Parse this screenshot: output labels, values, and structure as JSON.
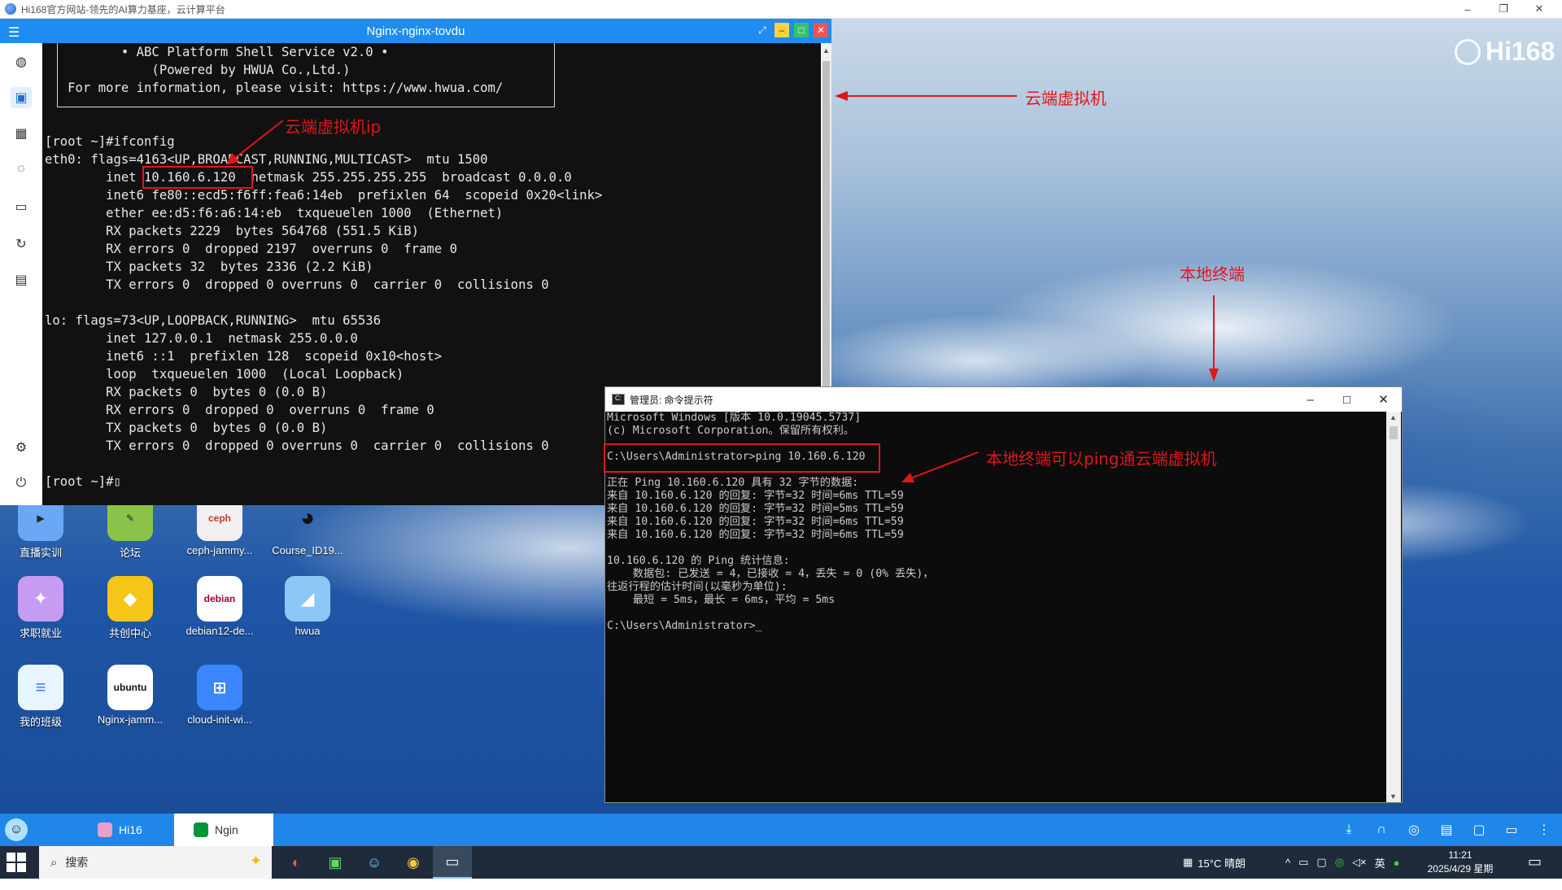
{
  "outer_window": {
    "title": "Hi168官方网站-领先的AI算力基座，云计算平台",
    "minimize": "–",
    "restore": "❐",
    "close": "✕"
  },
  "desktop": {
    "brand": "Hi168",
    "icons": [
      {
        "label": "直播实训",
        "icon": "video-play-icon",
        "color": "#6aa7f5"
      },
      {
        "label": "论坛",
        "icon": "forum-icon",
        "color": "#8bc34a"
      },
      {
        "label": "ceph-jammy...",
        "icon": "ceph-icon",
        "color": "#f0f0f0"
      },
      {
        "label": "Course_ID19...",
        "icon": "penguin-icon",
        "color": "#222222"
      },
      {
        "label": "求职就业",
        "icon": "job-icon",
        "color": "#c59cf2"
      },
      {
        "label": "共创中心",
        "icon": "cocreate-icon",
        "color": "#f5c518"
      },
      {
        "label": "debian12-de...",
        "icon": "debian-icon",
        "icon_text": "debian",
        "color": "#ffffff"
      },
      {
        "label": "hwua",
        "icon": "hwua-icon",
        "color": "#8cc8f5"
      },
      {
        "label": "我的班级",
        "icon": "class-icon",
        "color": "#e8f4ff"
      },
      {
        "label": "Nginx-jamm...",
        "icon": "ubuntu-icon",
        "icon_text": "ubuntu",
        "color": "#ffffff"
      },
      {
        "label": "cloud-init-wi...",
        "icon": "windows11-icon",
        "color": "#3a86ff"
      }
    ]
  },
  "annotations": {
    "vm_ip": "云端虚拟机ip",
    "cloud_vm": "云端虚拟机",
    "local_terminal": "本地终端",
    "ping_ok": "本地终端可以ping通云端虚拟机"
  },
  "nginx_window": {
    "title": "Nginx-nginx-tovdu",
    "sidebar": [
      "globe-icon",
      "terminal-icon",
      "apps-icon",
      "bulb-icon",
      "folder-icon",
      "refresh-icon",
      "save-icon",
      "settings-icon",
      "power-icon"
    ],
    "terminal_lines": [
      "          • ABC Platform Shell Service v2.0 •",
      "              (Powered by HWUA Co.,Ltd.)",
      "   For more information, please visit: https://www.hwua.com/",
      "",
      "",
      "[root ~]#ifconfig",
      "eth0: flags=4163<UP,BROADCAST,RUNNING,MULTICAST>  mtu 1500",
      "        inet 10.160.6.120  netmask 255.255.255.255  broadcast 0.0.0.0",
      "        inet6 fe80::ecd5:f6ff:fea6:14eb  prefixlen 64  scopeid 0x20<link>",
      "        ether ee:d5:f6:a6:14:eb  txqueuelen 1000  (Ethernet)",
      "        RX packets 2229  bytes 564768 (551.5 KiB)",
      "        RX errors 0  dropped 2197  overruns 0  frame 0",
      "        TX packets 32  bytes 2336 (2.2 KiB)",
      "        TX errors 0  dropped 0 overruns 0  carrier 0  collisions 0",
      "",
      "lo: flags=73<UP,LOOPBACK,RUNNING>  mtu 65536",
      "        inet 127.0.0.1  netmask 255.0.0.0",
      "        inet6 ::1  prefixlen 128  scopeid 0x10<host>",
      "        loop  txqueuelen 1000  (Local Loopback)",
      "        RX packets 0  bytes 0 (0.0 B)",
      "        RX errors 0  dropped 0  overruns 0  frame 0",
      "        TX packets 0  bytes 0 (0.0 B)",
      "        TX errors 0  dropped 0 overruns 0  carrier 0  collisions 0",
      "",
      "[root ~]#▯"
    ]
  },
  "cmd_window": {
    "title": "管理员: 命令提示符",
    "lines": [
      "Microsoft Windows [版本 10.0.19045.5737]",
      "(c) Microsoft Corporation。保留所有权利。",
      "",
      "C:\\Users\\Administrator>ping 10.160.6.120",
      "",
      "正在 Ping 10.160.6.120 具有 32 字节的数据:",
      "来自 10.160.6.120 的回复: 字节=32 时间=6ms TTL=59",
      "来自 10.160.6.120 的回复: 字节=32 时间=5ms TTL=59",
      "来自 10.160.6.120 的回复: 字节=32 时间=6ms TTL=59",
      "来自 10.160.6.120 的回复: 字节=32 时间=6ms TTL=59",
      "",
      "10.160.6.120 的 Ping 统计信息:",
      "    数据包: 已发送 = 4，已接收 = 4，丢失 = 0 (0% 丢失)，",
      "往返行程的估计时间(以毫秒为单位):",
      "    最短 = 5ms，最长 = 6ms，平均 = 5ms",
      "",
      "C:\\Users\\Administrator>_"
    ]
  },
  "dock": {
    "tabs": [
      {
        "label": "Hi16",
        "icon": "hi168-app-icon"
      },
      {
        "label": "Ngin",
        "icon": "nginx-icon"
      }
    ],
    "tray": [
      "download-icon",
      "headset-icon",
      "wechat-icon",
      "notes-icon",
      "chat-icon",
      "monitor-icon",
      "more-icon"
    ]
  },
  "taskbar": {
    "search_placeholder": "搜索",
    "pinned": [
      "app-red-icon",
      "notepad-icon",
      "qq-icon",
      "chrome-icon",
      "cmd-icon"
    ],
    "weather": "15°C  晴朗",
    "ime": "英",
    "time": "11:21",
    "date": "2025/4/29 星期二"
  }
}
